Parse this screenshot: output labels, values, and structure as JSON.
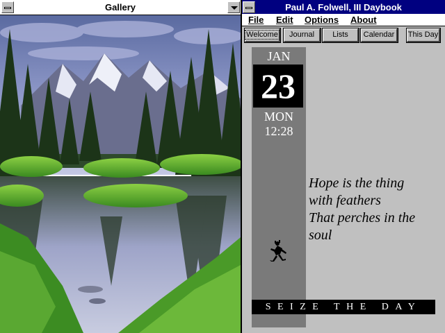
{
  "gallery": {
    "title": "Gallery",
    "image_description_icon": "mountain-lake-landscape"
  },
  "daybook": {
    "title": "Paul A. Folwell, III Daybook",
    "menu": [
      {
        "label": "File"
      },
      {
        "label": "Edit"
      },
      {
        "label": "Options"
      },
      {
        "label": "About"
      }
    ],
    "toolbar": {
      "welcome": "Welcome",
      "journal": "Journal",
      "lists": "Lists",
      "calendar": "Calendar",
      "this_day": "This Day"
    },
    "date": {
      "month": "JAN",
      "day": "23",
      "weekday": "MON",
      "time": "12:28"
    },
    "quote": {
      "line1": "Hope is the thing",
      "line2": "with feathers",
      "line3": "That perches in the",
      "line4": "soul"
    },
    "motto": "SEIZE THE DAY",
    "icon": "kokopelli-icon"
  },
  "colors": {
    "active_title": "#000080",
    "window_face": "#c0c0c0",
    "date_stripe": "#7a7a7a"
  }
}
